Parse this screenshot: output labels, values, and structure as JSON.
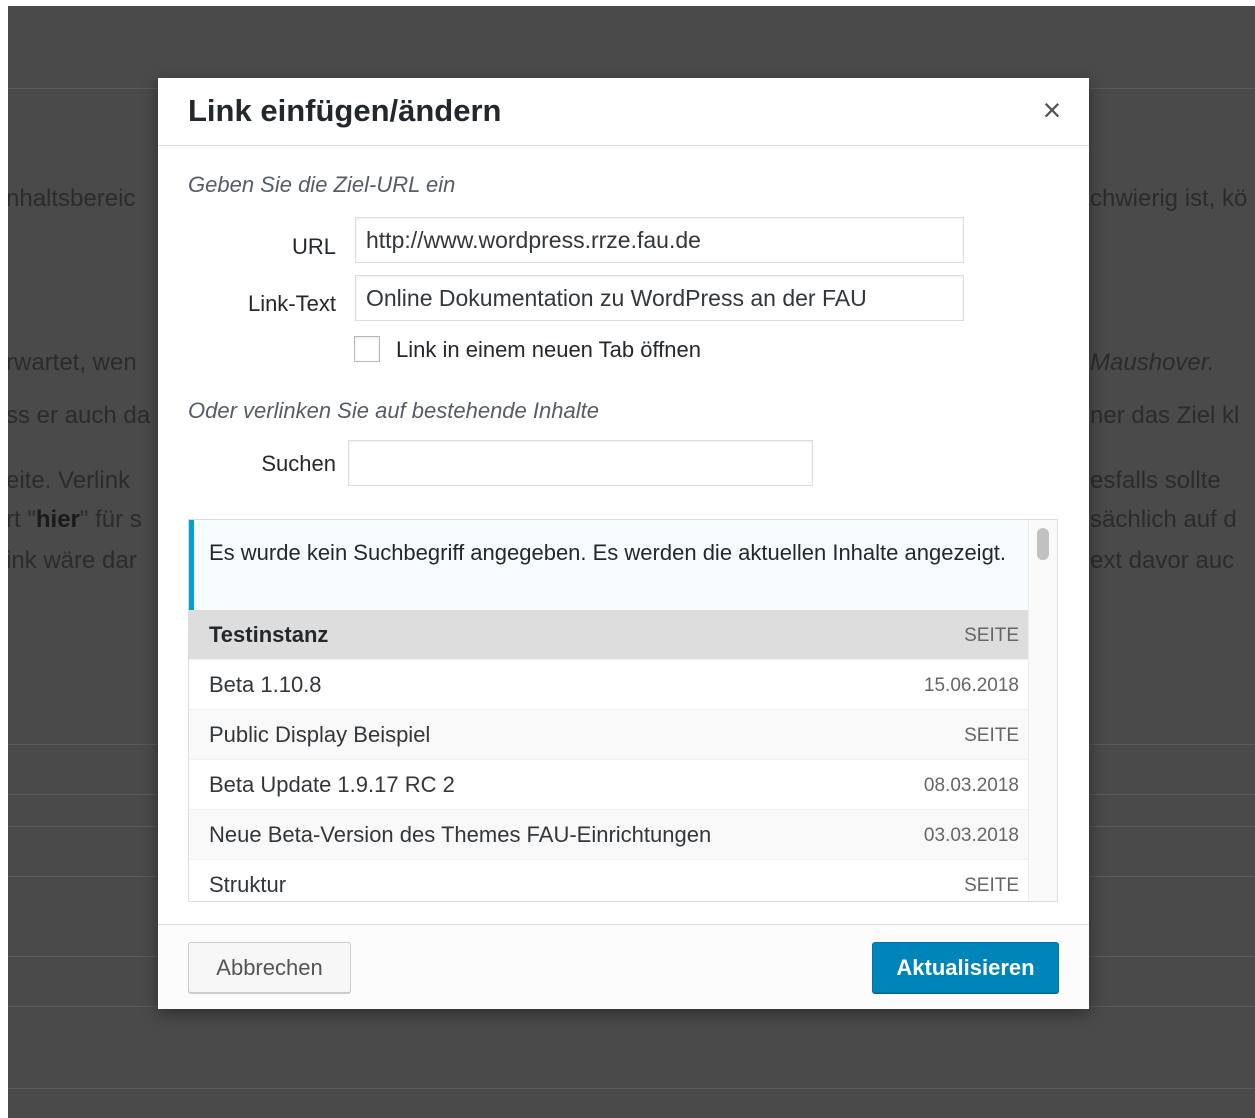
{
  "background": {
    "text_lines": [
      {
        "left": "nhaltsbereic",
        "right": "chwierig ist, kö"
      },
      {
        "left": "rwartet, wen",
        "right": "Maushover."
      },
      {
        "left": "ss er auch da",
        "right": "ner das Ziel kl"
      },
      {
        "left": "eite. Verlink",
        "right": "esfalls sollte"
      },
      {
        "left_prefix": "rt \"",
        "left_bold": "hier",
        "left_suffix": "\" für s",
        "right": "sächlich auf d"
      },
      {
        "left": "ink wäre dar",
        "right": "ext davor auc"
      }
    ]
  },
  "dialog": {
    "title": "Link einfügen/ändern",
    "close_symbol": "×",
    "url_section_heading": "Geben Sie die Ziel-URL ein",
    "url_label": "URL",
    "url_value": "http://www.wordpress.rrze.fau.de",
    "link_text_label": "Link-Text",
    "link_text_value": "Online Dokumentation zu WordPress an der FAU",
    "new_tab_label": "Link in einem neuen Tab öffnen",
    "new_tab_checked": false,
    "existing_section_heading": "Oder verlinken Sie auf bestehende Inhalte",
    "search_label": "Suchen",
    "search_value": "",
    "notice": "Es wurde kein Suchbegriff angegeben. Es werden die aktuellen Inhalte angezeigt.",
    "results": [
      {
        "title": "Testinstanz",
        "info": "SEITE",
        "selected": true
      },
      {
        "title": "Beta 1.10.8",
        "info": "15.06.2018",
        "selected": false
      },
      {
        "title": "Public Display Beispiel",
        "info": "SEITE",
        "selected": false
      },
      {
        "title": "Beta Update 1.9.17 RC 2",
        "info": "08.03.2018",
        "selected": false
      },
      {
        "title": "Neue Beta-Version des Themes FAU-Einrichtungen",
        "info": "03.03.2018",
        "selected": false
      },
      {
        "title": "Struktur",
        "info": "SEITE",
        "selected": false
      }
    ],
    "cancel_label": "Abbrechen",
    "submit_label": "Aktualisieren"
  },
  "colors": {
    "overlay": "#4a4a4a",
    "primary_button": "#0085ba",
    "notice_accent": "#00a0d2",
    "selected_row": "#dddddd"
  }
}
